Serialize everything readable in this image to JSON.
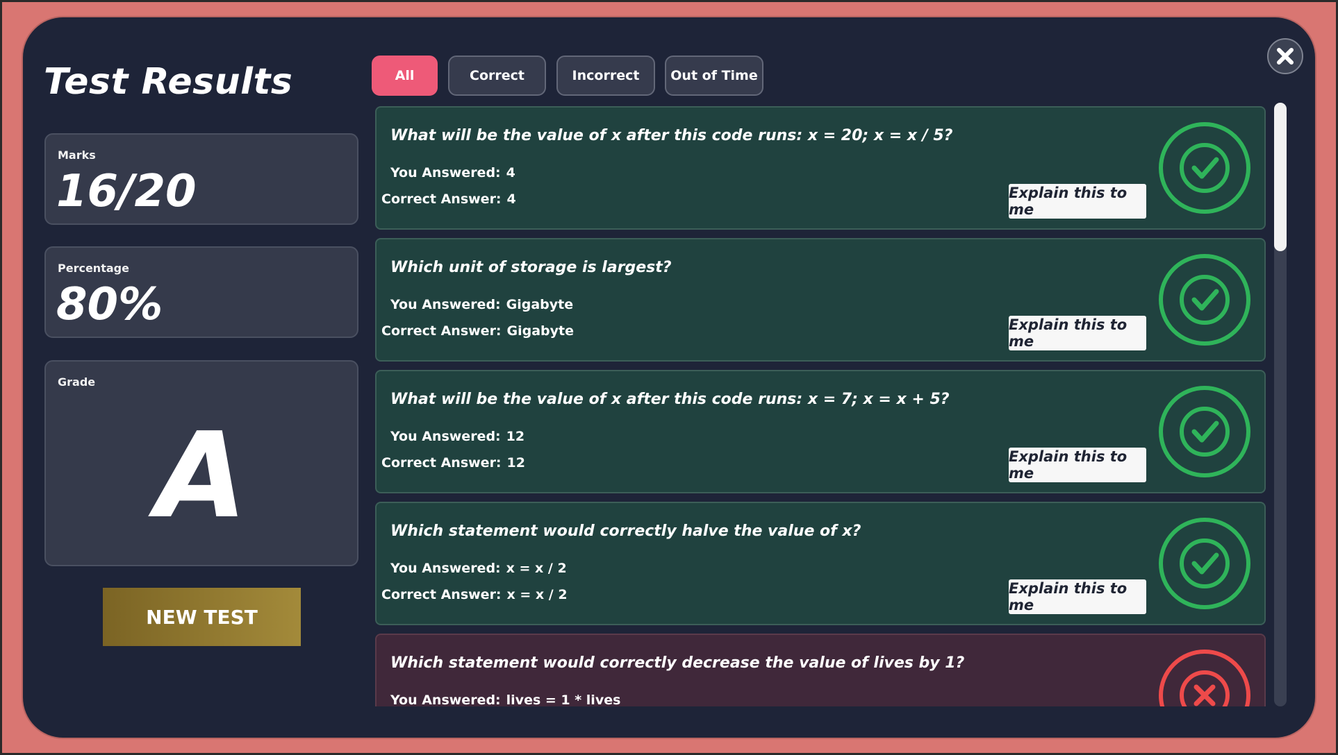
{
  "page_title": "Test Results",
  "stats": {
    "marks_label": "Marks",
    "marks_value": "16/20",
    "percentage_label": "Percentage",
    "percentage_value": "80%",
    "grade_label": "Grade",
    "grade_value": "A"
  },
  "new_test_label": "NEW TEST",
  "filters": [
    {
      "label": "All",
      "active": true
    },
    {
      "label": "Correct",
      "active": false
    },
    {
      "label": "Incorrect",
      "active": false
    },
    {
      "label": "Out of Time",
      "active": false
    }
  ],
  "answer_labels": {
    "you_answered": "You Answered:",
    "correct_answer": "Correct Answer:"
  },
  "explain_label": "Explain this to me",
  "questions": [
    {
      "question": "What will be the value of x after this code runs: x = 20; x = x / 5?",
      "you_answered": "4",
      "correct_answer": "4",
      "status": "correct"
    },
    {
      "question": "Which unit of storage is largest?",
      "you_answered": "Gigabyte",
      "correct_answer": "Gigabyte",
      "status": "correct"
    },
    {
      "question": "What will be the value of x after this code runs: x = 7; x = x + 5?",
      "you_answered": "12",
      "correct_answer": "12",
      "status": "correct"
    },
    {
      "question": "Which statement would correctly halve the value of x?",
      "you_answered": "x = x / 2",
      "correct_answer": "x = x / 2",
      "status": "correct"
    },
    {
      "question": "Which statement would correctly decrease the value of lives by 1?",
      "you_answered": "lives = 1 * lives",
      "status": "incorrect"
    }
  ],
  "colors": {
    "background": "#d97672",
    "modal": "#1e2438",
    "active_tab": "#ee5a78",
    "correct_card": "#20423f",
    "incorrect_card": "#40283a",
    "correct_icon": "#2fb45a",
    "incorrect_icon": "#ee4a4a",
    "new_test_button": "#8f7630"
  },
  "icons": {
    "close": "close-icon",
    "correct": "check-circle-icon",
    "incorrect": "x-circle-icon"
  }
}
